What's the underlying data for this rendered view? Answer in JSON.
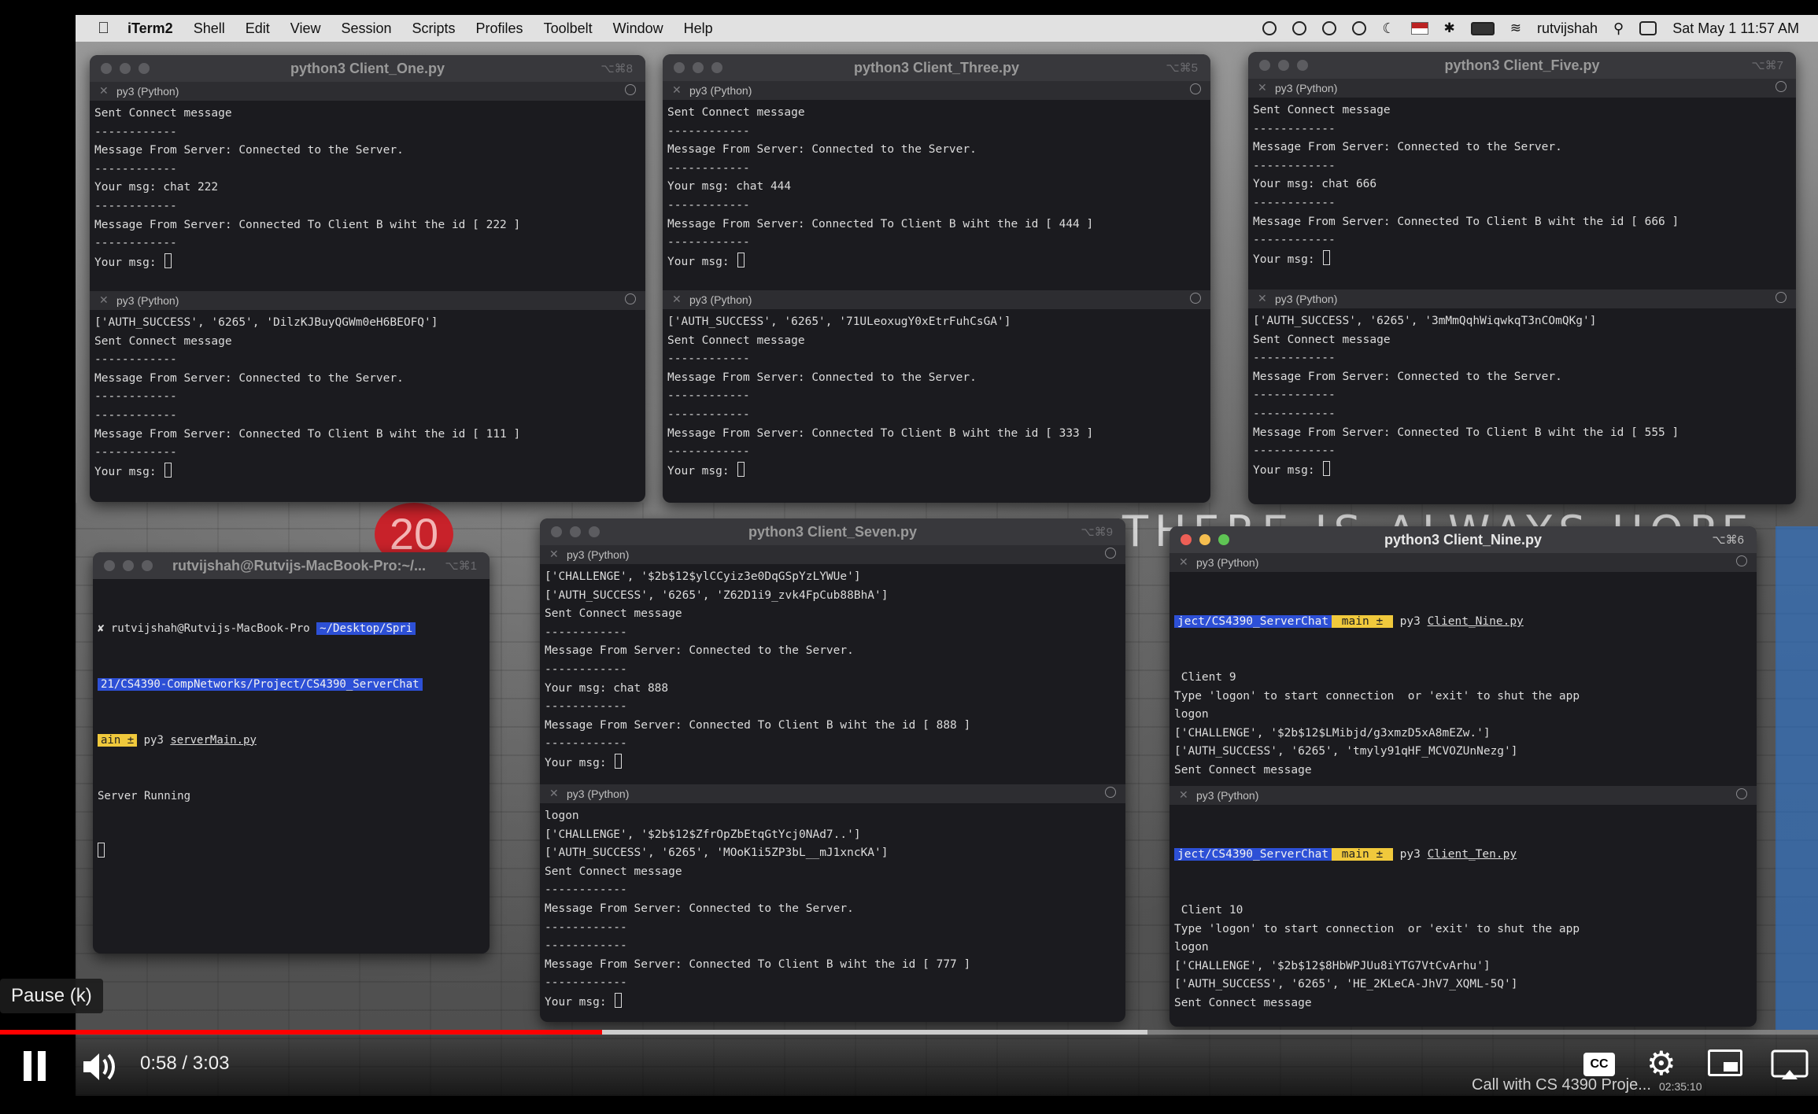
{
  "menubar": {
    "apple": "",
    "items": [
      "iTerm2",
      "Shell",
      "Edit",
      "View",
      "Session",
      "Scripts",
      "Profiles",
      "Toolbelt",
      "Window",
      "Help"
    ],
    "user": "rutvijshah",
    "datetime": "Sat May 1  11:57 AM"
  },
  "wallpaper": {
    "poster_number": "20",
    "graffiti": "THERE IS ALWAYS HOPE"
  },
  "windows": {
    "client_one": {
      "title": "python3 Client_One.py",
      "shortcut": "⌥⌘8",
      "pane1": {
        "tab": "py3 (Python)",
        "lines": [
          "Sent Connect message",
          "------------",
          "Message From Server: Connected to the Server.",
          "------------",
          "Your msg: chat 222",
          "------------",
          "Message From Server: Connected To Client B wiht the id [ 222 ]",
          "------------",
          "Your msg: "
        ]
      },
      "pane2": {
        "tab": "py3 (Python)",
        "lines": [
          "['AUTH_SUCCESS', '6265', 'DilzKJBuyQGWm0eH6BEOFQ']",
          "Sent Connect message",
          "------------",
          "Message From Server: Connected to the Server.",
          "------------",
          "------------",
          "Message From Server: Connected To Client B wiht the id [ 111 ]",
          "------------",
          "Your msg: "
        ]
      }
    },
    "client_three": {
      "title": "python3 Client_Three.py",
      "shortcut": "⌥⌘5",
      "pane1": {
        "tab": "py3 (Python)",
        "lines": [
          "Sent Connect message",
          "------------",
          "Message From Server: Connected to the Server.",
          "------------",
          "Your msg: chat 444",
          "------------",
          "Message From Server: Connected To Client B wiht the id [ 444 ]",
          "------------",
          "Your msg: "
        ]
      },
      "pane2": {
        "tab": "py3 (Python)",
        "lines": [
          "['AUTH_SUCCESS', '6265', '71ULeoxugY0xEtrFuhCsGA']",
          "Sent Connect message",
          "------------",
          "Message From Server: Connected to the Server.",
          "------------",
          "------------",
          "Message From Server: Connected To Client B wiht the id [ 333 ]",
          "------------",
          "Your msg: "
        ]
      }
    },
    "client_five": {
      "title": "python3 Client_Five.py",
      "shortcut": "⌥⌘7",
      "pane1": {
        "tab": "py3 (Python)",
        "lines": [
          "Sent Connect message",
          "------------",
          "Message From Server: Connected to the Server.",
          "------------",
          "Your msg: chat 666",
          "------------",
          "Message From Server: Connected To Client B wiht the id [ 666 ]",
          "------------",
          "Your msg: "
        ]
      },
      "pane2": {
        "tab": "py3 (Python)",
        "lines": [
          "['AUTH_SUCCESS', '6265', '3mMmQqhWiqwkqT3nCOmQKg']",
          "Sent Connect message",
          "------------",
          "Message From Server: Connected to the Server.",
          "------------",
          "------------",
          "Message From Server: Connected To Client B wiht the id [ 555 ]",
          "------------",
          "Your msg: "
        ]
      }
    },
    "server": {
      "title": "rutvijshah@Rutvijs-MacBook-Pro:~/...",
      "shortcut": "⌥⌘1",
      "prompt_user": "✘ rutvijshah@Rutvijs-MacBook-Pro",
      "prompt_path1": "~/Desktop/Spri",
      "prompt_path2": "21/CS4390-CompNetworks/Project/CS4390_ServerChat",
      "prompt_branch": "ain ±",
      "command_prefix": "py3 ",
      "command": "serverMain.py",
      "output": "Server Running"
    },
    "client_seven": {
      "title": "python3 Client_Seven.py",
      "shortcut": "⌥⌘9",
      "pane1": {
        "tab": "py3 (Python)",
        "lines": [
          "['CHALLENGE', '$2b$12$ylCCyiz3e0DqGSpYzLYWUe']",
          "['AUTH_SUCCESS', '6265', 'Z62D1i9_zvk4FpCub88BhA']",
          "Sent Connect message",
          "------------",
          "Message From Server: Connected to the Server.",
          "------------",
          "Your msg: chat 888",
          "------------",
          "Message From Server: Connected To Client B wiht the id [ 888 ]",
          "------------",
          "Your msg: "
        ]
      },
      "pane2": {
        "tab": "py3 (Python)",
        "lines": [
          "logon",
          "['CHALLENGE', '$2b$12$ZfrOpZbEtqGtYcj0NAd7..']",
          "['AUTH_SUCCESS', '6265', 'MOoK1i5ZP3bL__mJ1xncKA']",
          "Sent Connect message",
          "------------",
          "Message From Server: Connected to the Server.",
          "------------",
          "------------",
          "Message From Server: Connected To Client B wiht the id [ 777 ]",
          "------------",
          "Your msg: "
        ]
      }
    },
    "client_nine": {
      "title": "python3 Client_Nine.py",
      "shortcut": "⌥⌘6",
      "pane1": {
        "tab": "py3 (Python)",
        "prompt_path": "ject/CS4390_ServerChat",
        "prompt_branch": " main ± ",
        "command_prefix": " py3 ",
        "command": "Client_Nine.py",
        "lines": [
          " Client 9",
          "Type 'logon' to start connection  or 'exit' to shut the app",
          "logon",
          "['CHALLENGE', '$2b$12$LMibjd/g3xmzD5xA8mEZw.']",
          "['AUTH_SUCCESS', '6265', 'tmyly91qHF_MCVOZUnNezg']",
          "Sent Connect message",
          "------------",
          "Message From Server: Connected to the Server.",
          "------------",
          "Your msg: "
        ]
      },
      "pane2": {
        "tab": "py3 (Python)",
        "prompt_path": "ject/CS4390_ServerChat",
        "prompt_branch": " main ± ",
        "command_prefix": " py3 ",
        "command": "Client_Ten.py",
        "lines": [
          " Client 10",
          "Type 'logon' to start connection  or 'exit' to shut the app",
          "logon",
          "['CHALLENGE', '$2b$12$8HbWPJUu8iYTG7VtCvArhu']",
          "['AUTH_SUCCESS', '6265', 'HE_2KLeCA-JhV7_XQML-5Q']",
          "Sent Connect message",
          "------------",
          "Message From Server: Connected to the Server.",
          "------------",
          "Your msg: "
        ]
      }
    }
  },
  "player": {
    "tooltip": "Pause (k)",
    "time": "0:58 / 3:03",
    "progress": 0.331,
    "buffered": 0.3,
    "bottom_title": "Call with CS 4390 Proje...",
    "bottom_time": "02:35:10"
  },
  "colors": {
    "progress": "#ff0000",
    "prompt_path": "#2d50d6",
    "prompt_branch": "#f0c93c"
  }
}
